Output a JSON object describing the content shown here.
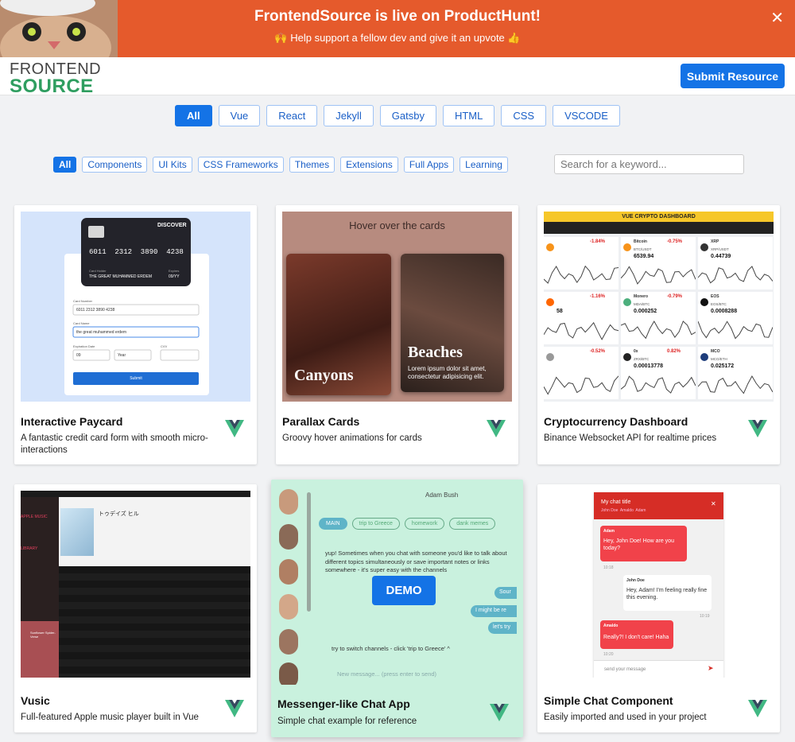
{
  "banner": {
    "title": "FrontendSource is live on ProductHunt!",
    "subtitle": "🙌 Help support a fellow dev and give it an upvote 👍",
    "close_glyph": "✕"
  },
  "header": {
    "logo_line1": "FRONTEND",
    "logo_line2": "SOURCE",
    "submit_label": "Submit Resource"
  },
  "frameworks": [
    "All",
    "Vue",
    "React",
    "Jekyll",
    "Gatsby",
    "HTML",
    "CSS",
    "VSCODE"
  ],
  "categories": [
    "All",
    "Components",
    "UI Kits",
    "CSS Frameworks",
    "Themes",
    "Extensions",
    "Full Apps",
    "Learning"
  ],
  "search": {
    "placeholder": "Search for a keyword..."
  },
  "cards": [
    {
      "title": "Interactive Paycard",
      "desc": "A fantastic credit card form with smooth micro-interactions",
      "icon": "vue-logo-icon"
    },
    {
      "title": "Parallax Cards",
      "desc": "Groovy hover animations for cards",
      "icon": "vue-logo-icon"
    },
    {
      "title": "Cryptocurrency Dashboard",
      "desc": "Binance Websocket API for realtime prices",
      "icon": "vue-logo-icon"
    },
    {
      "title": "Vusic",
      "desc": "Full-featured Apple music player built in Vue",
      "icon": "vue-logo-icon"
    },
    {
      "title": "Messenger-like Chat App",
      "desc": "Simple chat example for reference",
      "icon": "vue-logo-icon"
    },
    {
      "title": "Simple Chat Component",
      "desc": "Easily imported and used in your project",
      "icon": "vue-logo-icon"
    }
  ],
  "previews": {
    "paycard": {
      "brand": "DISCOVER",
      "number": "6011  2312  3890  4238",
      "holder_label": "Card Holder",
      "holder": "THE GREAT MUHAMMED ERDEM",
      "expires_label": "Expires",
      "expires": "09/YY",
      "field1_label": "Card Number",
      "field1_value": "6011 2312 3890 4238",
      "field2_label": "Card Name",
      "field2_value": "the great muhammed erdem",
      "field3_label": "Expiration Date",
      "field4_label": "CVV",
      "month": "09",
      "year": "Year",
      "button": "Submit"
    },
    "parallax": {
      "heading": "Hover over the cards",
      "card1": "Canyons",
      "card2": "Beaches",
      "card2_text": "Lorem ipsum dolor sit amet, consectetur adipisicing elit."
    },
    "crypto": {
      "header": "VUE CRYPTO DASHBOARD",
      "coins": [
        {
          "name": "",
          "pair": "",
          "change": "-1.84%",
          "price": ""
        },
        {
          "name": "Bitcoin",
          "pair": "BTC/USDT",
          "change": "-0.75%",
          "price": "6539.94"
        },
        {
          "name": "XRP",
          "pair": "XRP/USDT",
          "change": "",
          "price": "0.44739"
        },
        {
          "name": "",
          "pair": "",
          "change": "-1.16%",
          "price": "58"
        },
        {
          "name": "Monero",
          "pair": "MDA/BTC",
          "change": "-0.79%",
          "price": "0.000252"
        },
        {
          "name": "EOS",
          "pair": "EOS/BTC",
          "change": "",
          "price": "0.0008288"
        },
        {
          "name": "",
          "pair": "",
          "change": "-0.52%",
          "price": ""
        },
        {
          "name": "0x",
          "pair": "ZRX/BTC",
          "change": "0.82%",
          "price": "0.00013778"
        },
        {
          "name": "MCO",
          "pair": "MCO/ETH",
          "change": "",
          "price": "0.025172"
        }
      ]
    },
    "vusic": {
      "sidebar_title": "APPLE MUSIC",
      "library": "LIBRARY",
      "album": "トゥデイズ ヒル",
      "now_playing": "Sunflower Spider-Verse"
    },
    "messenger": {
      "name": "Adam Bush",
      "tags": [
        "MAIN",
        "trip to Greece",
        "homework",
        "dank memes"
      ],
      "msg1": "yup! Sometimes when you chat with someone you'd like to talk about different topics simultaneously or save important notes or links somewhere - it's super easy with the channels",
      "reply1": "Sour",
      "reply2": "I might be re",
      "reply3": "let's try",
      "msg2": "try to switch channels - click 'trip to Greece' ^",
      "input": "New message... (press enter to send)",
      "demo": "DEMO"
    },
    "simplechat": {
      "title": "My chat title",
      "members": "John Doe  Amaldo  Adam",
      "m1_name": "Adam",
      "m1": "Hey, John Doe! How are you today?",
      "m2_name": "John Doe",
      "m2": "Hey, Adam! I'm feeling really fine this evening.",
      "m3_name": "Amaldo",
      "m3": "Really?! I don't care! Haha",
      "input": "send your message",
      "t1": "10:18",
      "t2": "10:19",
      "t3": "10:20"
    }
  },
  "colors": {
    "banner": "#e55a2c",
    "primary": "#1473e6",
    "vue_green": "#41b883",
    "vue_dark": "#35495e",
    "logo_green": "#2f9e60"
  }
}
